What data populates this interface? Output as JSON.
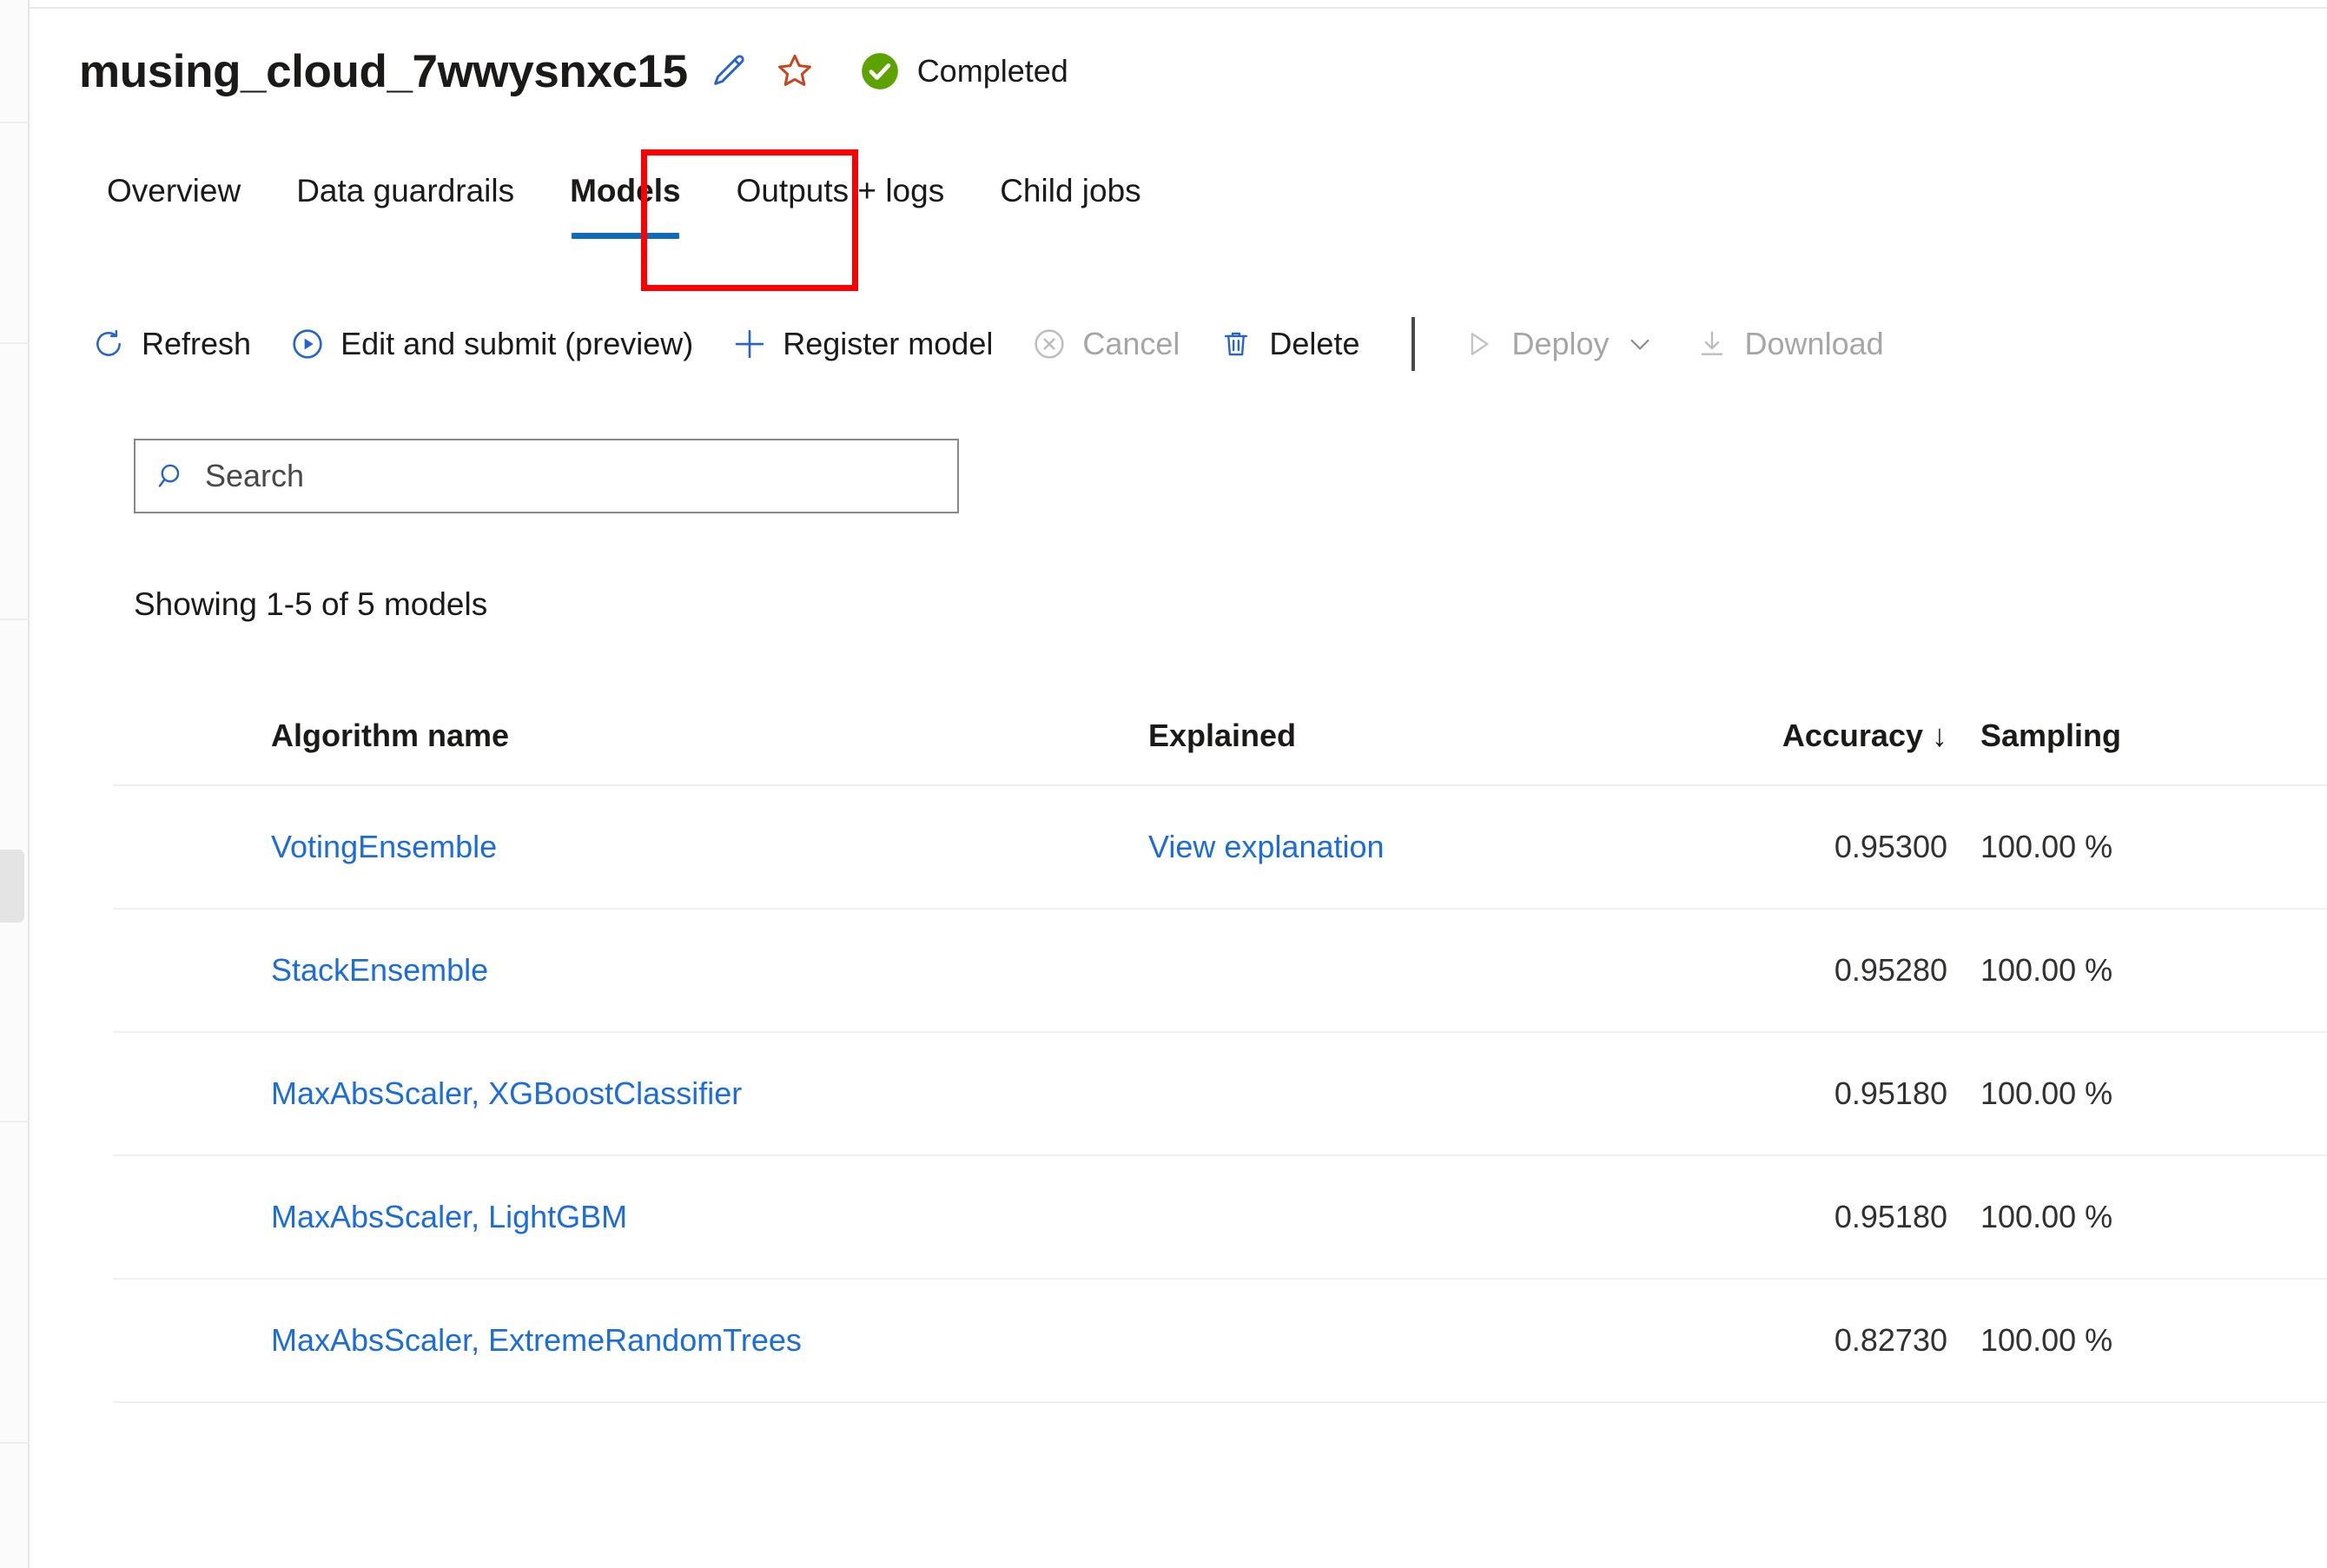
{
  "header": {
    "title": "musing_cloud_7wwysnxc15",
    "edit_icon": "pencil-icon",
    "favorite_icon": "star-icon",
    "status_icon": "completed-check-icon",
    "status_text": "Completed",
    "status_color": "#5ca300"
  },
  "tabs": [
    {
      "label": "Overview",
      "active": false
    },
    {
      "label": "Data guardrails",
      "active": false
    },
    {
      "label": "Models",
      "active": true
    },
    {
      "label": "Outputs + logs",
      "active": false
    },
    {
      "label": "Child jobs",
      "active": false
    }
  ],
  "tab_accent_color": "#0f6cbd",
  "annotation": {
    "color": "#ff0000",
    "target": "Models"
  },
  "commandbar": [
    {
      "label": "Refresh",
      "icon": "refresh-icon",
      "disabled": false
    },
    {
      "label": "Edit and submit (preview)",
      "icon": "play-circle-icon",
      "disabled": false
    },
    {
      "label": "Register model",
      "icon": "plus-icon",
      "disabled": false
    },
    {
      "label": "Cancel",
      "icon": "cancel-circle-icon",
      "disabled": true
    },
    {
      "label": "Delete",
      "icon": "trash-icon",
      "disabled": false
    },
    {
      "label": "Deploy",
      "icon": "play-triangle-icon",
      "disabled": true,
      "chevron": "chevron-down-icon"
    },
    {
      "label": "Download",
      "icon": "download-icon",
      "disabled": true
    }
  ],
  "search": {
    "placeholder": "Search",
    "value": "",
    "icon": "search-icon"
  },
  "results_summary": "Showing 1-5 of 5 models",
  "table": {
    "columns": [
      {
        "key": "algorithm",
        "label": "Algorithm name"
      },
      {
        "key": "explained",
        "label": "Explained"
      },
      {
        "key": "accuracy",
        "label": "Accuracy",
        "sort": "descending",
        "sort_glyph": "↓"
      },
      {
        "key": "sampling",
        "label": "Sampling"
      }
    ],
    "rows": [
      {
        "algorithm": "VotingEnsemble",
        "explained": "View explanation",
        "accuracy": "0.95300",
        "sampling": "100.00 %"
      },
      {
        "algorithm": "StackEnsemble",
        "explained": "",
        "accuracy": "0.95280",
        "sampling": "100.00 %"
      },
      {
        "algorithm": "MaxAbsScaler, XGBoostClassifier",
        "explained": "",
        "accuracy": "0.95180",
        "sampling": "100.00 %"
      },
      {
        "algorithm": "MaxAbsScaler, LightGBM",
        "explained": "",
        "accuracy": "0.95180",
        "sampling": "100.00 %"
      },
      {
        "algorithm": "MaxAbsScaler, ExtremeRandomTrees",
        "explained": "",
        "accuracy": "0.82730",
        "sampling": "100.00 %"
      }
    ]
  },
  "colors": {
    "link": "#1a6ddb",
    "icon_blue": "#2564cf",
    "disabled": "#a6a6a6"
  }
}
